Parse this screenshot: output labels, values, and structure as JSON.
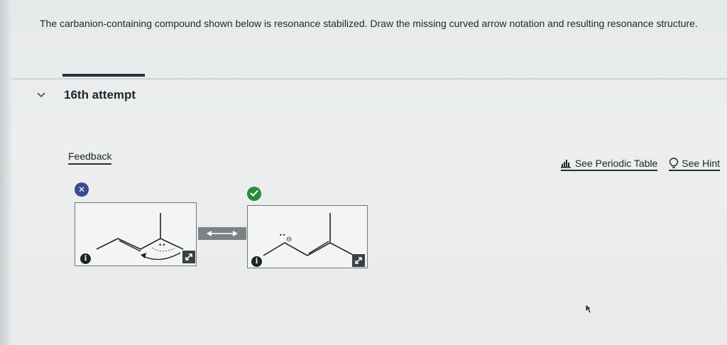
{
  "question": {
    "text": "The carbanion-containing compound shown below is resonance stabilized. Draw the missing curved arrow notation and resulting resonance structure."
  },
  "attempt": {
    "label": "16th attempt"
  },
  "feedback": {
    "label": "Feedback"
  },
  "links": {
    "periodic_table": "See Periodic Table",
    "hint": "See Hint"
  },
  "structures": {
    "left_status": "incorrect",
    "right_status": "correct",
    "lone_pair": "••",
    "charge": "⊖",
    "info_glyph": "i"
  },
  "icons": {
    "chevron": "chevron-down-icon",
    "periodic": "bar-chart-icon",
    "hint": "lightbulb-icon",
    "x": "x-icon",
    "check": "check-icon",
    "expand": "expand-icon",
    "info": "info-icon",
    "arrow": "double-headed-arrow-icon",
    "cursor": "mouse-pointer-icon"
  },
  "colors": {
    "incorrect_badge": "#3c4a8e",
    "correct_badge": "#2c8a3e",
    "text": "#1f2428"
  }
}
